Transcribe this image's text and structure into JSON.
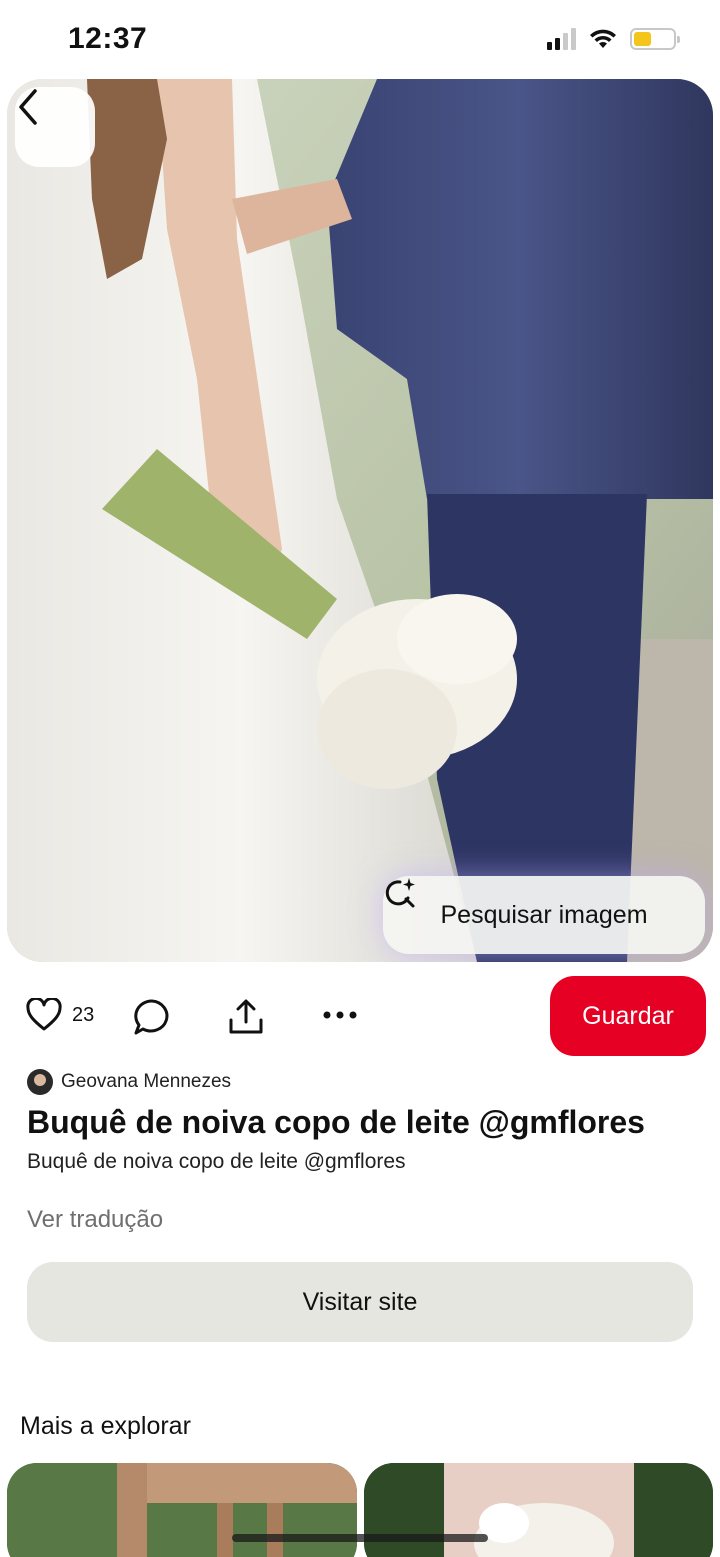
{
  "status_bar": {
    "time": "12:37",
    "signal_icon": "cellular-signal-icon",
    "wifi_icon": "wifi-icon",
    "battery_icon": "battery-icon",
    "battery_level": 0.45,
    "battery_color": "#f4c51a"
  },
  "hero": {
    "image_description": "wedding couple photo",
    "back_icon": "chevron-left-icon",
    "search_image_label": "Pesquisar imagem",
    "search_image_icon": "visual-search-sparkle-icon"
  },
  "actions": {
    "like_icon": "heart-icon",
    "like_count": "23",
    "comment_icon": "comment-bubble-icon",
    "share_icon": "share-upload-icon",
    "more_icon": "ellipsis-icon",
    "save_label": "Guardar",
    "save_color": "#e60023"
  },
  "pin": {
    "author_name": "Geovana Mennezes",
    "title": "Buquê de noiva copo de leite @gmflores",
    "description": "Buquê de noiva copo de leite @gmflores",
    "translate_label": "Ver tradução",
    "visit_label": "Visitar site"
  },
  "explore": {
    "title": "Mais a explorar"
  }
}
